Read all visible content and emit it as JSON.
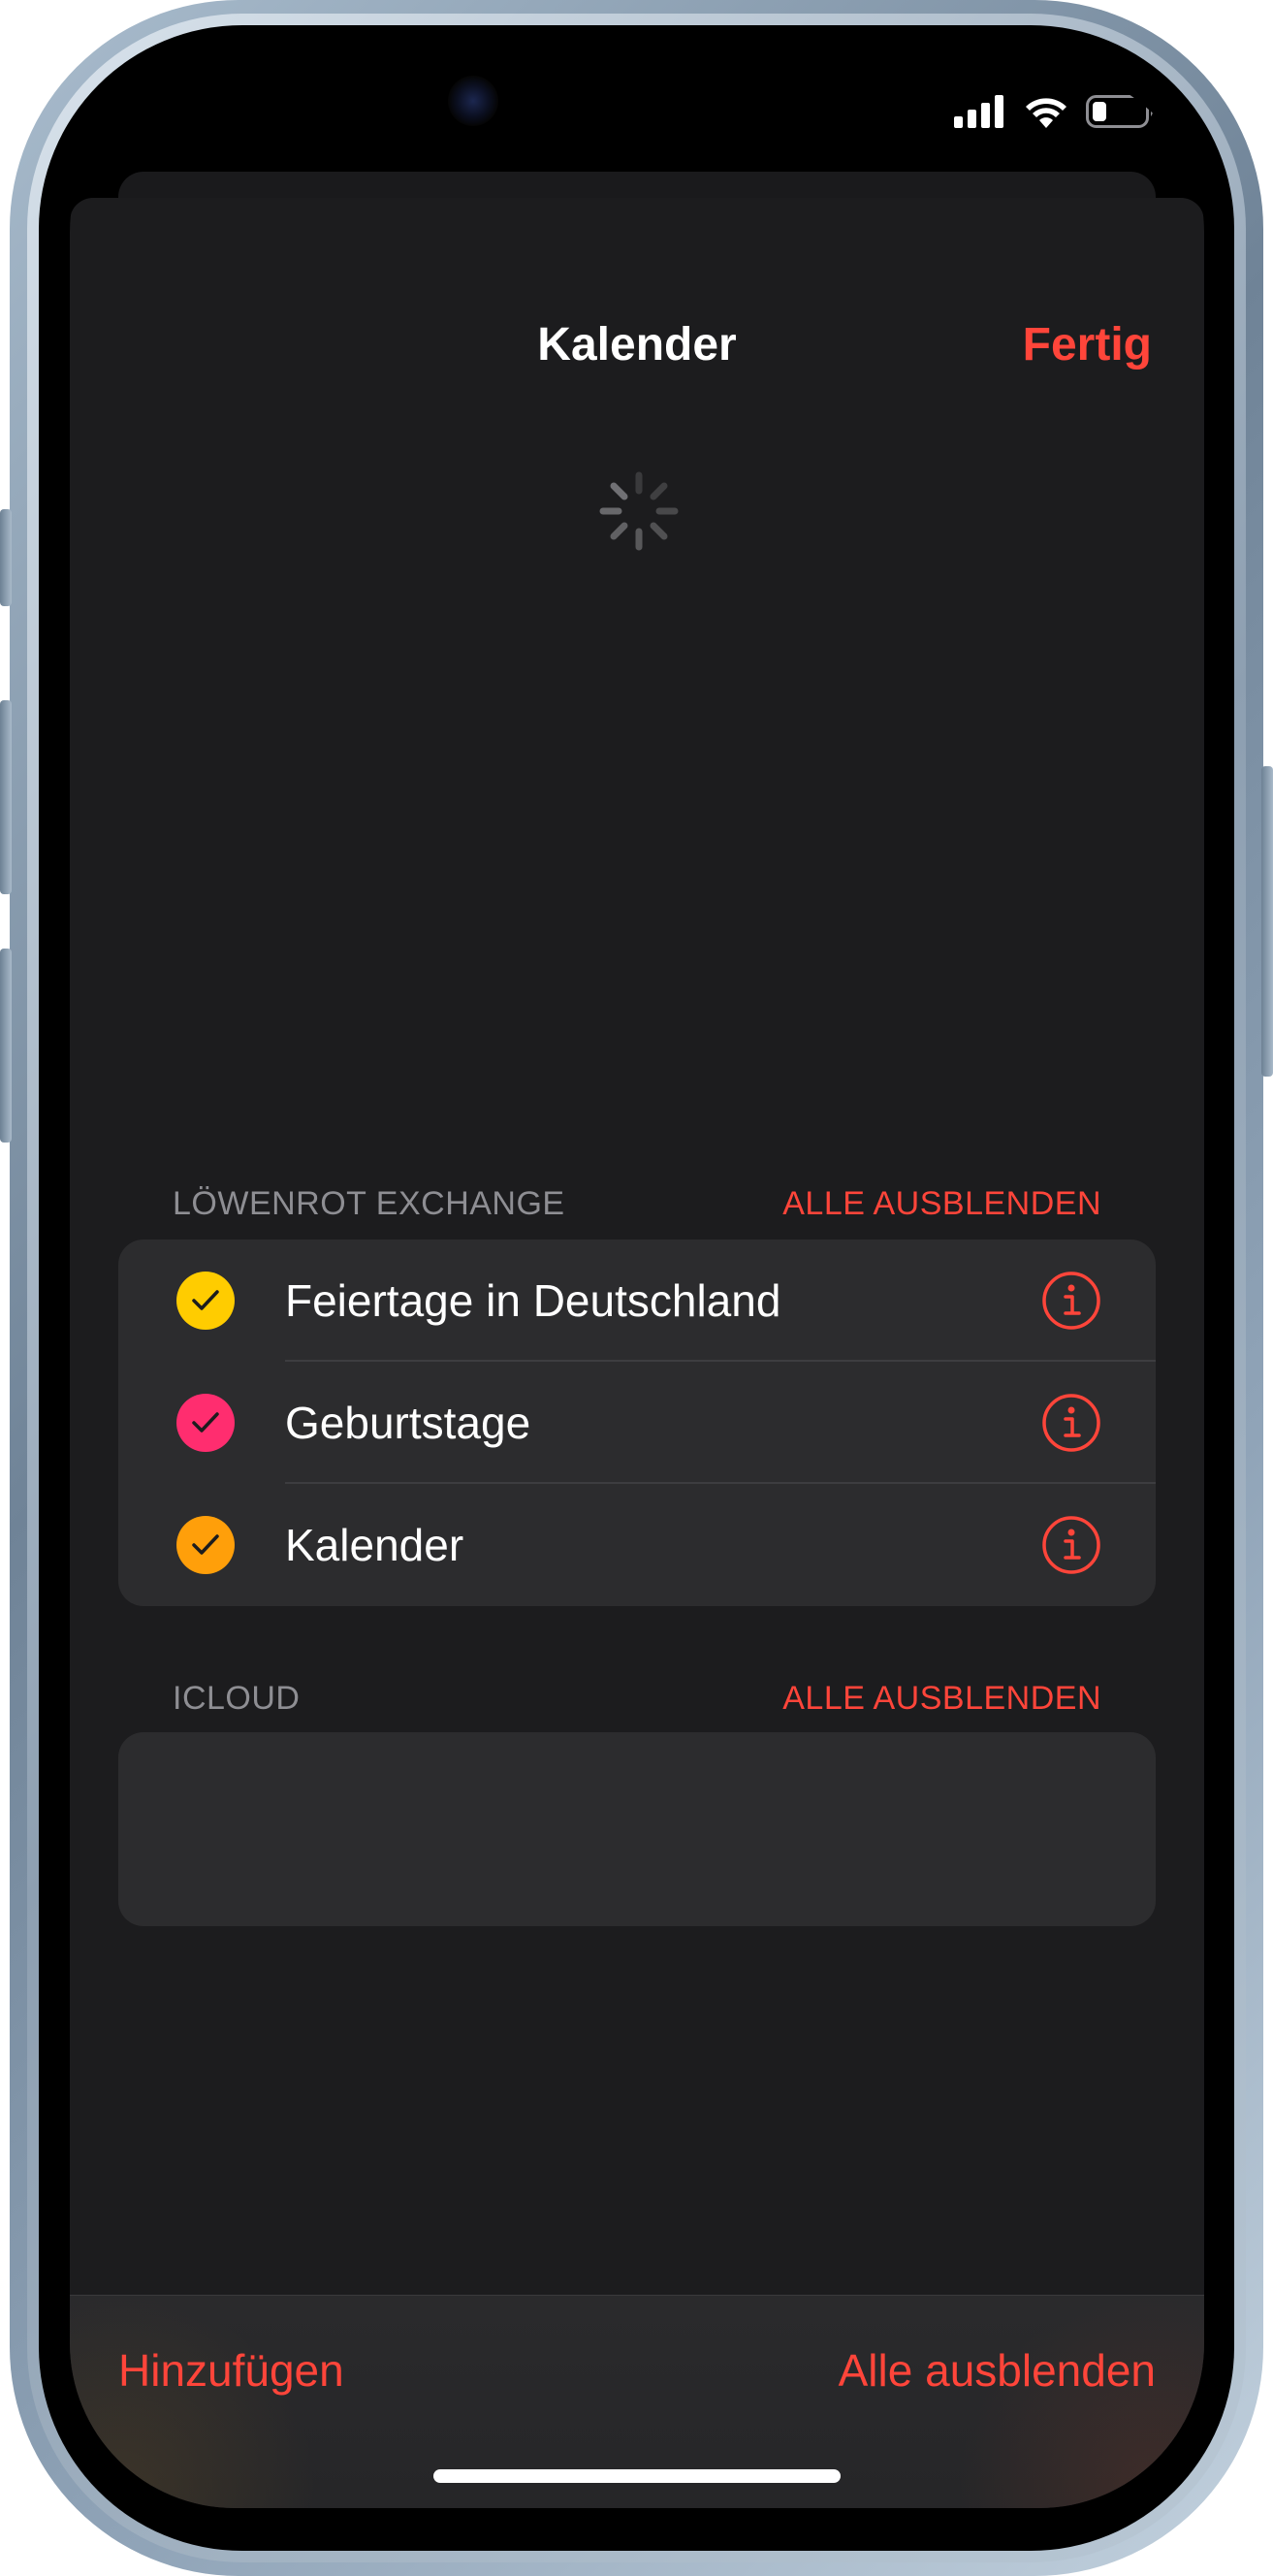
{
  "nav": {
    "title": "Kalender",
    "done_label": "Fertig"
  },
  "sections": [
    {
      "title": "LÖWENROT EXCHANGE",
      "action": "ALLE AUSBLENDEN",
      "items": [
        {
          "label": "Feiertage in Deutschland",
          "color": "#ffcc00",
          "checked": true,
          "icon": "info-icon"
        },
        {
          "label": "Geburtstage",
          "color": "#ff2d6f",
          "checked": true,
          "icon": "info-icon"
        },
        {
          "label": "Kalender",
          "color": "#ff9f0a",
          "checked": true,
          "icon": "info-icon"
        }
      ]
    },
    {
      "title": "ICLOUD",
      "action": "ALLE AUSBLENDEN"
    }
  ],
  "toolbar": {
    "add_label": "Hinzufügen",
    "hide_all_label": "Alle ausblenden"
  },
  "colors": {
    "accent": "#ff453a",
    "background": "#1c1c1e",
    "cell": "#2c2c2e"
  },
  "icons": {
    "spinner": "loading-spinner-icon",
    "signal": "cellular-signal-icon",
    "wifi": "wifi-icon",
    "battery": "battery-icon"
  }
}
